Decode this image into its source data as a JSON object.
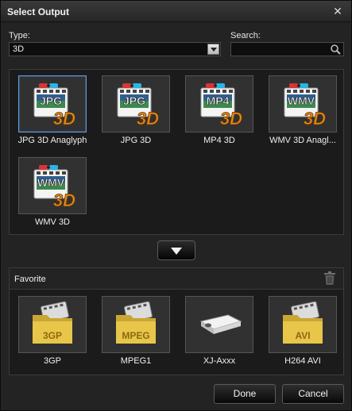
{
  "window": {
    "title": "Select Output"
  },
  "type_filter": {
    "label": "Type:",
    "value": "3D"
  },
  "search": {
    "label": "Search:",
    "value": ""
  },
  "outputs": [
    {
      "label": "JPG 3D Anaglyph",
      "badge": "JPG",
      "selected": true
    },
    {
      "label": "JPG 3D",
      "badge": "JPG",
      "selected": false
    },
    {
      "label": "MP4 3D",
      "badge": "MP4",
      "selected": false
    },
    {
      "label": "WMV 3D Anagl...",
      "badge": "WMV",
      "selected": false
    },
    {
      "label": "WMV 3D",
      "badge": "WMV",
      "selected": false
    }
  ],
  "tile_overlay": "3D",
  "favorite": {
    "title": "Favorite",
    "items": [
      {
        "label": "3GP",
        "badge": "3GP",
        "kind": "folder"
      },
      {
        "label": "MPEG1",
        "badge": "MPEG",
        "kind": "folder"
      },
      {
        "label": "XJ-Axxx",
        "badge": "",
        "kind": "projector"
      },
      {
        "label": "H264 AVI",
        "badge": "AVI",
        "kind": "folder"
      }
    ]
  },
  "buttons": {
    "done": "Done",
    "cancel": "Cancel"
  },
  "colors": {
    "accent_3d": "#e08a1a",
    "selection": "#6c9ad0",
    "folder": "#e8c64a"
  },
  "icons": {
    "close": "close-icon",
    "dropdown": "chevron-down-icon",
    "search": "search-icon",
    "expand": "expand-arrow-icon",
    "delete": "trash-icon"
  }
}
